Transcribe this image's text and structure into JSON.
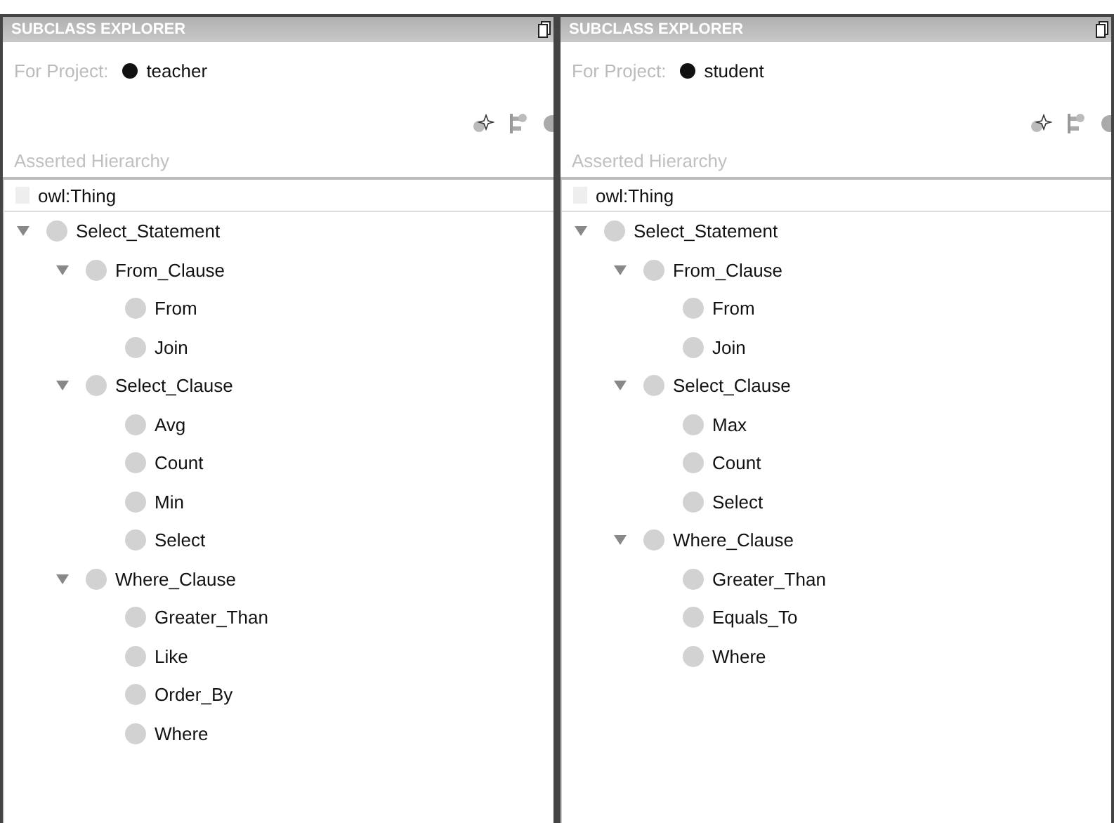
{
  "panels": [
    {
      "title": "SUBCLASS EXPLORER",
      "project_label": "For Project:",
      "project": "teacher",
      "hierarchy_label": "Asserted Hierarchy",
      "root": "owl:Thing",
      "tree": [
        {
          "label": "Select_Statement",
          "expanded": true,
          "children": [
            {
              "label": "From_Clause",
              "expanded": true,
              "children": [
                {
                  "label": "From"
                },
                {
                  "label": "Join"
                }
              ]
            },
            {
              "label": "Select_Clause",
              "expanded": true,
              "children": [
                {
                  "label": "Avg"
                },
                {
                  "label": "Count"
                },
                {
                  "label": "Min"
                },
                {
                  "label": "Select"
                }
              ]
            },
            {
              "label": "Where_Clause",
              "expanded": true,
              "children": [
                {
                  "label": "Greater_Than"
                },
                {
                  "label": "Like"
                },
                {
                  "label": "Order_By"
                },
                {
                  "label": "Where"
                }
              ]
            }
          ]
        }
      ]
    },
    {
      "title": "SUBCLASS EXPLORER",
      "project_label": "For Project:",
      "project": "student",
      "hierarchy_label": "Asserted Hierarchy",
      "root": "owl:Thing",
      "tree": [
        {
          "label": "Select_Statement",
          "expanded": true,
          "children": [
            {
              "label": "From_Clause",
              "expanded": true,
              "children": [
                {
                  "label": "From"
                },
                {
                  "label": "Join"
                }
              ]
            },
            {
              "label": "Select_Clause",
              "expanded": true,
              "children": [
                {
                  "label": "Max"
                },
                {
                  "label": "Count"
                },
                {
                  "label": "Select"
                }
              ]
            },
            {
              "label": "Where_Clause",
              "expanded": true,
              "children": [
                {
                  "label": "Greater_Than"
                },
                {
                  "label": "Equals_To"
                },
                {
                  "label": "Where"
                }
              ]
            }
          ]
        }
      ]
    }
  ]
}
